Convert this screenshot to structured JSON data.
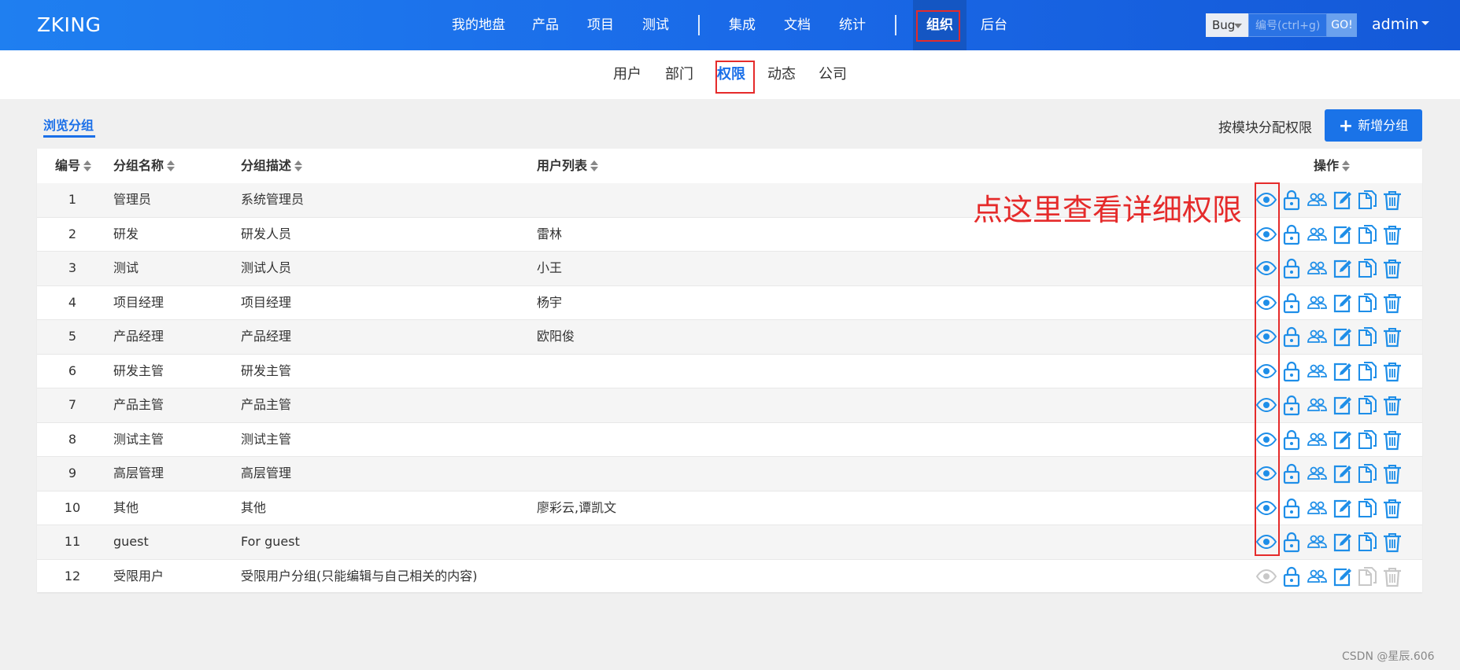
{
  "brand": "ZKING",
  "nav": {
    "items": [
      {
        "label": "我的地盘"
      },
      {
        "label": "产品"
      },
      {
        "label": "项目"
      },
      {
        "label": "测试"
      },
      {
        "label": "集成"
      },
      {
        "label": "文档"
      },
      {
        "label": "统计"
      },
      {
        "label": "组织",
        "active": true
      },
      {
        "label": "后台"
      }
    ]
  },
  "search": {
    "type": "Bug",
    "placeholder": "编号(ctrl+g)",
    "go": "GO!"
  },
  "user": {
    "name": "admin"
  },
  "subnav": {
    "items": [
      {
        "label": "用户"
      },
      {
        "label": "部门"
      },
      {
        "label": "权限",
        "active": true
      },
      {
        "label": "动态"
      },
      {
        "label": "公司"
      }
    ]
  },
  "toolbar": {
    "browse_tab": "浏览分组",
    "assign_link": "按模块分配权限",
    "new_button": "新增分组"
  },
  "table": {
    "headers": {
      "id": "编号",
      "name": "分组名称",
      "desc": "分组描述",
      "users": "用户列表",
      "actions": "操作"
    },
    "rows": [
      {
        "id": "1",
        "name": "管理员",
        "desc": "系统管理员",
        "users": ""
      },
      {
        "id": "2",
        "name": "研发",
        "desc": "研发人员",
        "users": "雷林"
      },
      {
        "id": "3",
        "name": "测试",
        "desc": "测试人员",
        "users": "小王"
      },
      {
        "id": "4",
        "name": "项目经理",
        "desc": "项目经理",
        "users": "杨宇"
      },
      {
        "id": "5",
        "name": "产品经理",
        "desc": "产品经理",
        "users": "欧阳俊"
      },
      {
        "id": "6",
        "name": "研发主管",
        "desc": "研发主管",
        "users": ""
      },
      {
        "id": "7",
        "name": "产品主管",
        "desc": "产品主管",
        "users": ""
      },
      {
        "id": "8",
        "name": "测试主管",
        "desc": "测试主管",
        "users": ""
      },
      {
        "id": "9",
        "name": "高层管理",
        "desc": "高层管理",
        "users": ""
      },
      {
        "id": "10",
        "name": "其他",
        "desc": "其他",
        "users": "廖彩云,谭凯文"
      },
      {
        "id": "11",
        "name": "guest",
        "desc": "For guest",
        "users": ""
      },
      {
        "id": "12",
        "name": "受限用户",
        "desc": "受限用户分组(只能编辑与自己相关的内容)",
        "users": "",
        "limited": true
      }
    ],
    "action_icons": [
      "eye-icon",
      "lock-icon",
      "users-icon",
      "edit-icon",
      "copy-icon",
      "trash-icon"
    ]
  },
  "annotation": "点这里查看详细权限",
  "watermark": "CSDN @星辰.606",
  "colors": {
    "accent": "#1a73e8",
    "icon": "#1e8ee8",
    "icon_disabled": "#c8c8c8",
    "highlight": "#e52b2b"
  }
}
